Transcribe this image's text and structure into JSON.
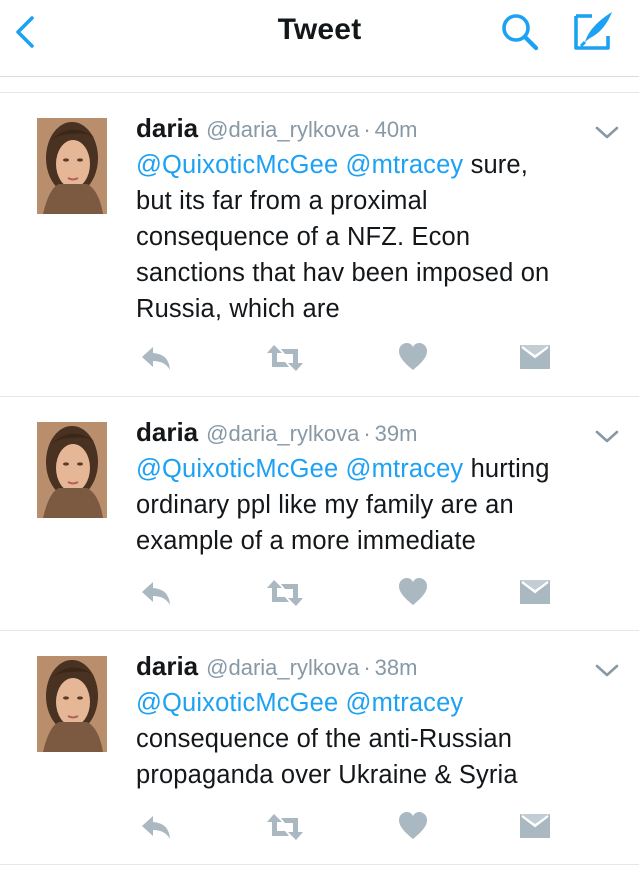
{
  "nav": {
    "title": "Tweet"
  },
  "tweets": [
    {
      "name": "daria",
      "handle": "@daria_rylkova",
      "separator": "·",
      "time": "40m",
      "mentions": [
        "@QuixoticMcGee",
        "@mtracey"
      ],
      "lines": [
        " sure,",
        "but its far from a proximal",
        "consequence of a NFZ. Econ",
        "sanctions that hav been imposed on",
        "Russia, which are"
      ]
    },
    {
      "name": "daria",
      "handle": "@daria_rylkova",
      "separator": "·",
      "time": "39m",
      "mentions": [
        "@QuixoticMcGee",
        "@mtracey"
      ],
      "lines": [
        " hurting",
        "ordinary ppl like my family are an",
        "example of a more immediate"
      ]
    },
    {
      "name": "daria",
      "handle": "@daria_rylkova",
      "separator": "·",
      "time": "38m",
      "mentions": [
        "@QuixoticMcGee",
        "@mtracey"
      ],
      "lines": [
        "",
        "consequence of the anti-Russian",
        "propaganda over Ukraine & Syria"
      ]
    }
  ],
  "icons": {
    "back": "chevron-left-icon",
    "search": "search-icon",
    "compose": "compose-icon",
    "more": "chevron-down-icon",
    "reply": "reply-icon",
    "retweet": "retweet-icon",
    "like": "heart-icon",
    "message": "direct-message-icon"
  },
  "colors": {
    "accent": "#1da1f2",
    "text": "#14171a",
    "muted": "#8899a6",
    "action_icon": "#aab8c2",
    "divider": "#e1e8ed"
  }
}
